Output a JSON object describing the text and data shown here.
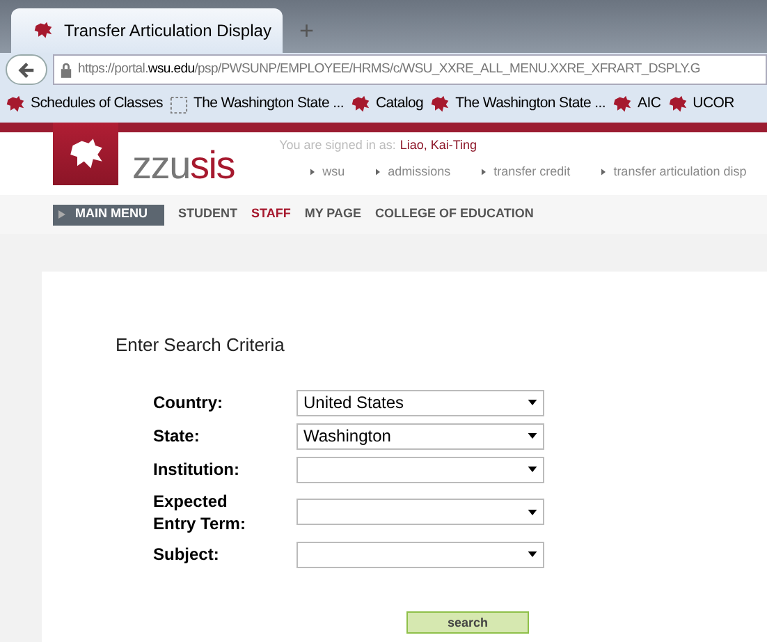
{
  "browser": {
    "tab_title": "Transfer Articulation Display",
    "new_tab": "+",
    "url_host": "https://portal.",
    "url_domain": "wsu.edu",
    "url_path": "/psp/PWSUNP/EMPLOYEE/HRMS/c/WSU_XXRE_ALL_MENU.XXRE_XFRART_DSPLY.G",
    "bookmarks": [
      {
        "kind": "logo",
        "label": "Schedules of Classes"
      },
      {
        "kind": "blank",
        "label": "The Washington State ..."
      },
      {
        "kind": "logo",
        "label": "Catalog"
      },
      {
        "kind": "logo",
        "label": "The Washington State ..."
      },
      {
        "kind": "logo",
        "label": "AIC"
      },
      {
        "kind": "logo",
        "label": "UCOR"
      }
    ]
  },
  "header": {
    "logo_prefix": "zzu",
    "logo_suffix": "sis",
    "signed_in_label": "You are signed in as:",
    "user": "Liao, Kai-Ting",
    "breadcrumbs": [
      "wsu",
      "admissions",
      "transfer credit",
      "transfer articulation disp"
    ],
    "main_menu": "MAIN MENU",
    "nav": [
      {
        "label": "STUDENT",
        "selected": false
      },
      {
        "label": "STAFF",
        "selected": true
      },
      {
        "label": "MY PAGE",
        "selected": false
      },
      {
        "label": "COLLEGE OF EDUCATION",
        "selected": false
      }
    ]
  },
  "form": {
    "title": "Enter Search Criteria",
    "fields": [
      {
        "label": "Country:",
        "value": "United States"
      },
      {
        "label": "State:",
        "value": "Washington"
      },
      {
        "label": "Institution:"
      },
      {
        "label": "Expected Entry Term:"
      },
      {
        "label": "Subject:"
      }
    ],
    "button": "search"
  }
}
